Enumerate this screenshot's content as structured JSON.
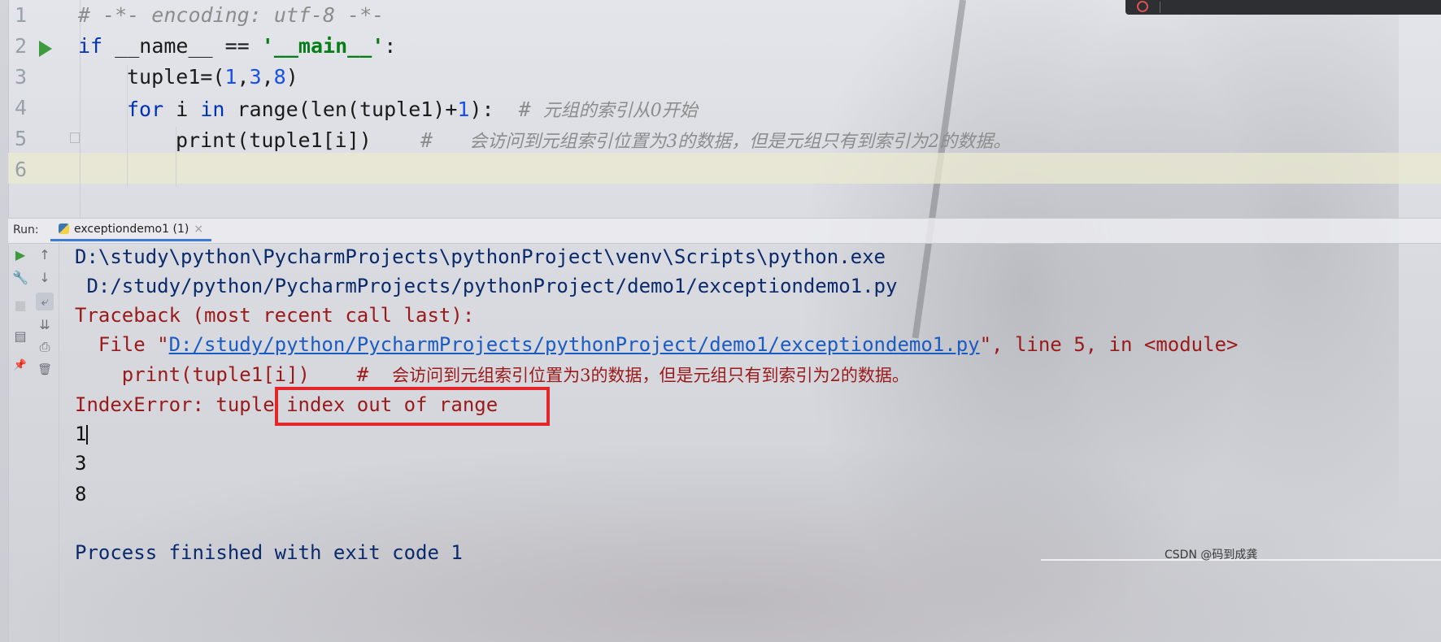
{
  "editor": {
    "line_numbers": [
      "1",
      "2",
      "3",
      "4",
      "5",
      "6"
    ],
    "lines": {
      "l1": "# -*- encoding: utf-8 -*-",
      "l2_kw": "if",
      "l2_mid": " __name__ == ",
      "l2_str": "'__main__'",
      "l2_end": ":",
      "l3_a": "tuple1=(",
      "l3_n1": "1",
      "l3_c1": ",",
      "l3_n2": "3",
      "l3_c2": ",",
      "l3_n3": "8",
      "l3_end": ")",
      "l4_for": "for",
      "l4_i": " i ",
      "l4_in": "in",
      "l4_range": " range(len(tuple1)+",
      "l4_n": "1",
      "l4_end": "):  ",
      "l4_hash": "# ",
      "l4_cmt": "元组的索引从0开始",
      "l5_code": "print(tuple1[i])    ",
      "l5_hash": "#   ",
      "l5_cmt": "会访问到元组索引位置为3的数据，但是元组只有到索引为2的数据。"
    }
  },
  "run_panel": {
    "label": "Run:",
    "tab_label": "exceptiondemo1 (1)",
    "tab_close": "×",
    "tools": {
      "run_again": "▶",
      "up": "↑",
      "down": "↓",
      "settings": "🔧",
      "stop": "■",
      "soft_wrap": "⤶",
      "scroll_end": "⇊",
      "layout": "▤",
      "print": "⎙",
      "pin": "📌",
      "trash": "🗑"
    }
  },
  "console": {
    "cmd_line1": "D:\\study\\python\\PycharmProjects\\pythonProject\\venv\\Scripts\\python.exe",
    "cmd_line2": " D:/study/python/PycharmProjects/pythonProject/demo1/exceptiondemo1.py",
    "traceback": "Traceback (most recent call last):",
    "file_prefix": "  File \"",
    "file_link": "D:/study/python/PycharmProjects/pythonProject/demo1/exceptiondemo1.py",
    "file_suffix": "\", line 5, in <module>",
    "src_code": "    print(tuple1[i])    #  ",
    "src_cmt": "会访问到元组索引位置为3的数据，但是元组只有到索引为2的数据。",
    "error_prefix": "IndexError: tuple ",
    "error_highlight": "index out of range",
    "out1": "1",
    "out2": "3",
    "out3": "8",
    "finished": "Process finished with exit code 1"
  },
  "watermark": "CSDN @码到成龚",
  "colors": {
    "highlight_box": "#e3262b",
    "keyword": "#0033b3",
    "string": "#067d17",
    "number": "#1750eb",
    "error_text": "#9a1a1a",
    "console_text": "#0a2a6b",
    "link": "#1a5bc4",
    "run_green": "#3d9b3d"
  }
}
